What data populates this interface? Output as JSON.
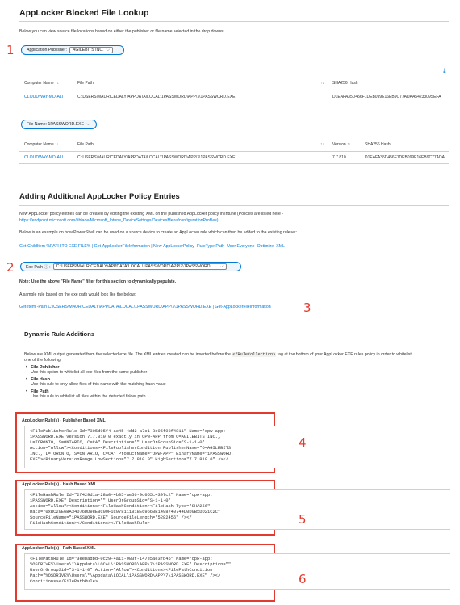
{
  "lookup": {
    "title": "AppLocker Blocked File Lookup",
    "description": "Below you can view source file locations based on either the publisher or file name selected in the drop downs.",
    "publisher_filter": {
      "label": "Application Publisher:",
      "value": "AGILEBITS INC."
    },
    "table1": {
      "columns": [
        "Computer Name",
        "File Path",
        "SHA256 Hash"
      ],
      "row": {
        "computer": "CLOUDWAY-MD-ALI",
        "path": "C:\\USERS\\MAURICEDALY\\APPDATA\\LOCAL\\1PASSWORD\\APP\\7\\1PASSWORD.EXE",
        "hash": "D1EAFA35D456F1DEB099E16EB9C77ADAA5423309SEFA"
      }
    },
    "filename_filter": {
      "label": "File Name: 1PASSWORD.EXE"
    },
    "table2": {
      "columns": [
        "Computer Name",
        "File Path",
        "Version",
        "SHA256 Hash"
      ],
      "row": {
        "computer": "CLOUDWAY-MD-ALI",
        "path": "C:\\USERS\\MAURICEDALY\\APPDATA\\LOCAL\\1PASSWORD\\APP\\7\\1PASSWORD.EXE",
        "version": "7.7.810",
        "hash": "D1EAFA35D456F1DEB099E16EB9C77ADA"
      }
    }
  },
  "adding": {
    "title": "Adding Additional AppLocker Policy Entries",
    "para1": "New AppLocker policy entries can be created by editing the existing XML on the published AppLocker policy in Intune (Policies are listed here -",
    "para1_link": "https://endpoint.microsoft.com/#blade/Microsoft_Intune_DeviceSettings/DevicesMenu/configurationProfiles)",
    "para2": "Below is an example on how PowerShell can be used on a source device to create an AppLocker rule which can then be added to the existing ruleset:",
    "cmd1": "Get-ChildItem %PATH TO EXE FILE% | Get-AppLockerFileInformation | New-AppLockerPolicy -RuleType Path -User Everyone -Optimize -XML",
    "exe_path": {
      "label": "Exe Path ⓘ :",
      "value": "C:\\USERS\\MAURICEDALY\\APPDATA\\LOCAL\\1PASSWORD\\APP\\7\\1PASSWORD..."
    },
    "note": "Note: Use the above \"File Name\" filter for this section to dynamically populate.",
    "sample_intro": "A sample rule based on the exe path would look like the below:",
    "cmd2": "Get-Item -Path C:\\USERS\\MAURICEDALY\\APPDATA\\LOCAL\\1PASSWORD\\APP\\7\\1PASSWORD.EXE | Get-AppLockerFileInformation"
  },
  "dynamic": {
    "title": "Dynamic Rule Additions",
    "intro_a": "Below are XML output generated from the selected exe file. The XML entries created can be inserted before the",
    "intro_code": "</RuleCollection>",
    "intro_b": "tag at the bottom of your AppLocker EXE rules policy in order to whitelist",
    "intro_c": "one of the following:",
    "items": [
      {
        "title": "File Publisher",
        "desc": "Use this option to whitelist all exe files from the same publisher"
      },
      {
        "title": "File Hash",
        "desc": "Use this rule to only allow files of this name with the matching hash value"
      },
      {
        "title": "File Path",
        "desc": "Use this rule to whitelist all files within the detected folder path"
      }
    ]
  },
  "rules": [
    {
      "title": "AppLocker Rule(s) - Publisher Based XML",
      "xml": "<FilePublisherRule Id=\"305d05f4-ae45-4dd2-a7e1-3c95f93f4811\" Name=\"opw-app:\n1PASSWORD.EXE version 7.7.810.0 exactly in OPW-APP from O=AGILEBITS INC.,\nL=TORONTO, S=ONTARIO, C=CA\" Description=\"\" UserOrGroupSid=\"S-1-1-0\"\nAction=\"Allow\"><Conditions><FilePublisherCondition PublisherName=\"O=AGILEBITS\nINC., L=TORONTO, S=ONTARIO, C=CA\" ProductName=\"OPW-APP\" BinaryName=\"1PASSWORD.\nEXE\"><BinaryVersionRange LowSection=\"7.7.810.0\" HighSection=\"7.7.810.0\" /></"
    },
    {
      "title": "AppLocker Rule(s) - Hash Based XML",
      "xml": "<FileHashRule Id=\"2f429d1a-28a0-4b05-ae56-9c055c4397c2\" Name=\"opw-app:\n1PASSWORD.EXE\" Description=\"\" UserOrGroupSid=\"S-1-1-0\"\nAction=\"Allow\"><Conditions><FileHashCondition><FileHash Type=\"SHA256\"\nData=\"0xBC20E6BA34D76DD98E8C09F1C978111818E69668E1498740744D0D0B5DD21C2C\"\nSourceFileName=\"1PASSWORD.EXE\" SourceFileLength=\"5282456\" /></\nFileHashCondition></Conditions></FileHashRule>"
    },
    {
      "title": "AppLocker Rule(s) - Path Based XML",
      "xml": "<FilePathRule Id=\"3eebadbd-0c29-4a11-983f-147e5ae3fb45\" Name=\"opw-app:\n%OSDRIVE%\\Users\\*\\Appdata\\LOCAL\\1PASSWORD\\APP\\7\\1PASSWORD.EXE\" Description=\"\"\nUserOrGroupSid=\"S-1-1-0\" Action=\"Allow\"><Conditions><FilePathCondition\nPath=\"%OSDRIVE%\\Users\\*\\Appdata\\LOCAL\\1PASSWORD\\APP\\7\\1PASSWORD.EXE\" /></\nConditions></FilePathRule>"
    }
  ],
  "annotations": [
    "1",
    "2",
    "3",
    "4",
    "5",
    "6"
  ],
  "colors": {
    "accent": "#0078d4",
    "annotation_red": "#e23a2e"
  },
  "icons": {
    "download": "download-icon",
    "sort": "sort-icon",
    "chevron": "chevron-down-icon"
  }
}
